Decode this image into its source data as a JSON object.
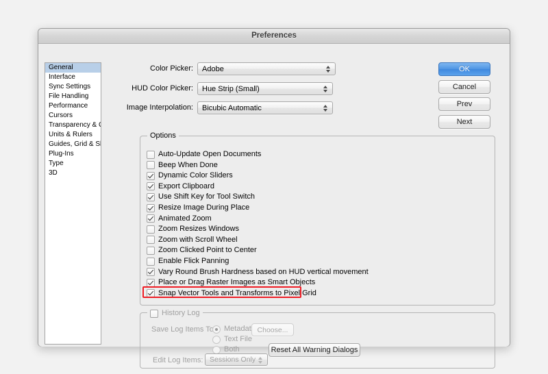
{
  "window": {
    "title": "Preferences"
  },
  "sidebar": {
    "items": [
      {
        "label": "General",
        "selected": true
      },
      {
        "label": "Interface",
        "selected": false
      },
      {
        "label": "Sync Settings",
        "selected": false
      },
      {
        "label": "File Handling",
        "selected": false
      },
      {
        "label": "Performance",
        "selected": false
      },
      {
        "label": "Cursors",
        "selected": false
      },
      {
        "label": "Transparency & Gamut",
        "selected": false
      },
      {
        "label": "Units & Rulers",
        "selected": false
      },
      {
        "label": "Guides, Grid & Slices",
        "selected": false
      },
      {
        "label": "Plug-Ins",
        "selected": false
      },
      {
        "label": "Type",
        "selected": false
      },
      {
        "label": "3D",
        "selected": false
      }
    ]
  },
  "popups": [
    {
      "label": "Color Picker:",
      "value": "Adobe"
    },
    {
      "label": "HUD Color Picker:",
      "value": "Hue Strip (Small)"
    },
    {
      "label": "Image Interpolation:",
      "value": "Bicubic Automatic"
    }
  ],
  "options": {
    "title": "Options",
    "checkboxes": [
      {
        "label": "Auto-Update Open Documents",
        "checked": false,
        "highlighted": false
      },
      {
        "label": "Beep When Done",
        "checked": false,
        "highlighted": false
      },
      {
        "label": "Dynamic Color Sliders",
        "checked": true,
        "highlighted": false
      },
      {
        "label": "Export Clipboard",
        "checked": true,
        "highlighted": false
      },
      {
        "label": "Use Shift Key for Tool Switch",
        "checked": true,
        "highlighted": false
      },
      {
        "label": "Resize Image During Place",
        "checked": true,
        "highlighted": false
      },
      {
        "label": "Animated Zoom",
        "checked": true,
        "highlighted": false
      },
      {
        "label": "Zoom Resizes Windows",
        "checked": false,
        "highlighted": false
      },
      {
        "label": "Zoom with Scroll Wheel",
        "checked": false,
        "highlighted": false
      },
      {
        "label": "Zoom Clicked Point to Center",
        "checked": false,
        "highlighted": false
      },
      {
        "label": "Enable Flick Panning",
        "checked": false,
        "highlighted": false
      },
      {
        "label": "Vary Round Brush Hardness based on HUD vertical movement",
        "checked": true,
        "highlighted": false
      },
      {
        "label": "Place or Drag Raster Images as Smart Objects",
        "checked": true,
        "highlighted": false
      },
      {
        "label": "Snap Vector Tools and Transforms to Pixel Grid",
        "checked": true,
        "highlighted": true
      }
    ]
  },
  "history_log": {
    "title": "History Log",
    "enabled": false,
    "save_log_items_to_label": "Save Log Items To:",
    "radios": [
      {
        "label": "Metadata",
        "selected": true
      },
      {
        "label": "Text File",
        "selected": false
      },
      {
        "label": "Both",
        "selected": false
      }
    ],
    "choose_button": "Choose...",
    "edit_log_items_label": "Edit Log Items:",
    "edit_log_items_value": "Sessions Only"
  },
  "reset_button": "Reset All Warning Dialogs",
  "action_buttons": [
    {
      "label": "OK",
      "style": "default"
    },
    {
      "label": "Cancel",
      "style": "normal"
    },
    {
      "label": "Prev",
      "style": "normal"
    },
    {
      "label": "Next",
      "style": "normal"
    }
  ],
  "colors": {
    "highlight_red": "#ee1c24",
    "selection_blue": "#b8cfe8",
    "default_button_blue": "#4e95e4"
  }
}
